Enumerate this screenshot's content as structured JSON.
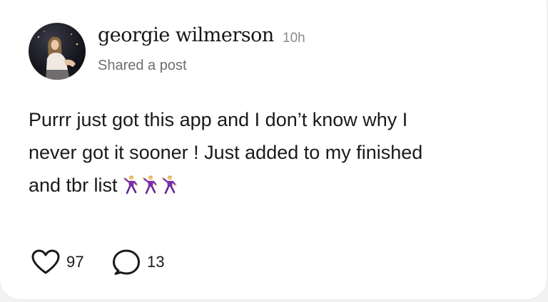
{
  "post": {
    "author": {
      "name": "georgie wilmerson",
      "time_ago": "10h",
      "activity": "Shared a post"
    },
    "body_lines": [
      "Purrr just got this app and I don’t know why I",
      "never got it sooner ! Just added to my finished",
      "and tbr list"
    ],
    "emoji": [
      "dancing-man-emoji",
      "dancing-man-emoji",
      "dancing-man-emoji"
    ],
    "likes": "97",
    "comments": "13"
  },
  "colors": {
    "text": "#1a1a1a",
    "muted": "#6e6e6e",
    "emoji_purple": "#7b2fa6"
  }
}
